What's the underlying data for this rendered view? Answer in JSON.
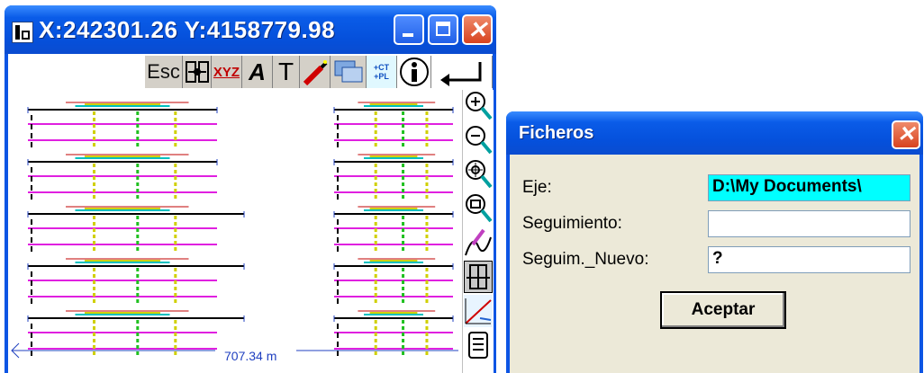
{
  "main_window": {
    "title": "X:242301.26 Y:4158779.98",
    "toolbar": {
      "esc_label": "Esc",
      "xyz_label": "XYZ",
      "text_label": "A",
      "pick_label": "T",
      "ct_label": "+CT",
      "pl_label": "+PL",
      "info_label": "i"
    },
    "sidebar": [
      "zoom-in-icon",
      "zoom-out-icon",
      "pan-icon",
      "zoom-window-icon",
      "profile-pen-icon",
      "section-icon",
      "slope-icon",
      "list-icon"
    ],
    "scale_label": "707.34 m"
  },
  "dialog": {
    "title": "Ficheros",
    "fields": [
      {
        "label": "Eje:",
        "value": "D:\\My Documents\\"
      },
      {
        "label": "Seguimiento:",
        "value": ""
      },
      {
        "label": "Seguim._Nuevo:",
        "value": "?"
      }
    ],
    "accept_label": "Aceptar"
  },
  "colors": {
    "titlebar": "#0a5ce8",
    "close_button": "#d8431f",
    "highlight_field": "#00ffff",
    "dialog_bg": "#ece9d8"
  }
}
